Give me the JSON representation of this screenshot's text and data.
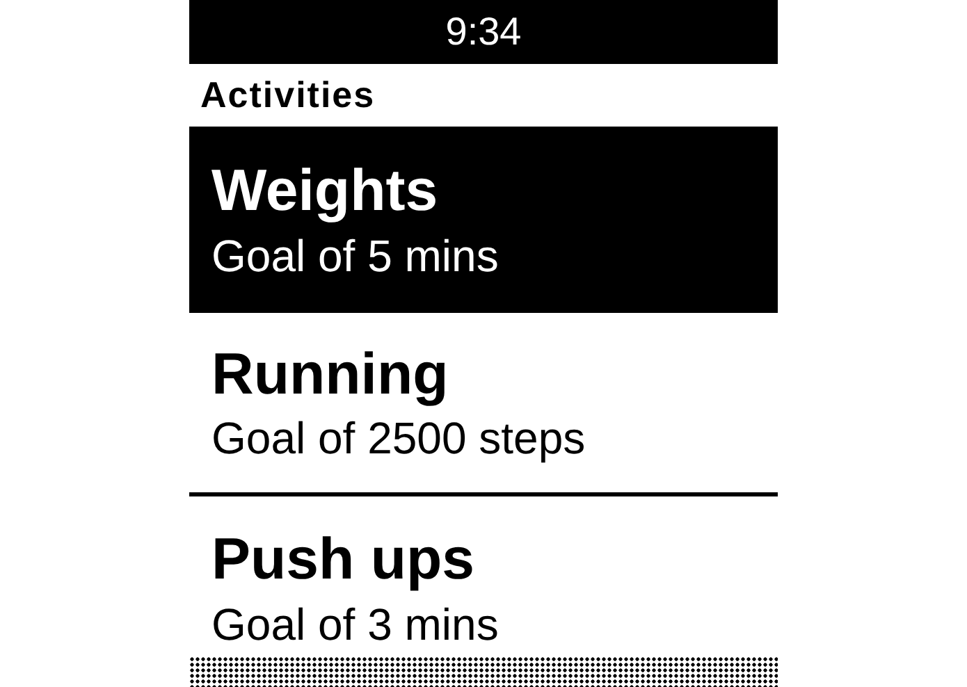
{
  "status_bar": {
    "time": "9:34"
  },
  "header": {
    "title": "Activities"
  },
  "activities": [
    {
      "name": "Weights",
      "goal": "Goal of 5 mins",
      "selected": true
    },
    {
      "name": "Running",
      "goal": "Goal of 2500 steps",
      "selected": false
    },
    {
      "name": "Push ups",
      "goal": "Goal of 3 mins",
      "selected": false
    }
  ]
}
